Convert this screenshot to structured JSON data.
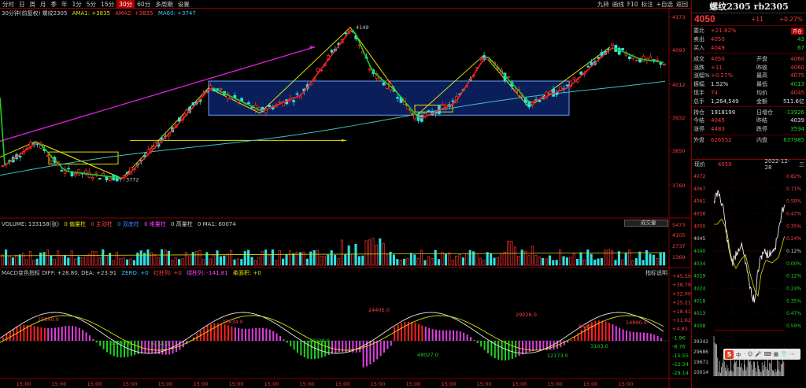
{
  "toolbar": {
    "items": [
      "分时",
      "日",
      "周",
      "月",
      "季",
      "年",
      "1分",
      "5分",
      "15分",
      "30分",
      "60分",
      "多周期",
      "设置"
    ],
    "active_index": 9,
    "right_items": [
      "九转",
      "画线",
      "F10",
      "标注",
      "+自选",
      "返回"
    ]
  },
  "main_legend": {
    "title": "30分钟(前复权) 螺纹2305",
    "ma1": "AMA1: +3835",
    "ma2": "AMA2: +3835",
    "ma60": "MA60: +3747",
    "colors": {
      "ma1": "#e0e000",
      "ma2": "#ff4040",
      "ma60": "#40c0ff"
    }
  },
  "price_axis": [
    "4173",
    "4093",
    "4012",
    "3932",
    "3850",
    "3760"
  ],
  "annotations": {
    "high": "4149",
    "low": "3772"
  },
  "volume_legend": {
    "text": "VOLUME: 133158(张)",
    "items": [
      "0 偏量柱",
      "0 主动柱",
      "0 双底柱",
      "0 堆量柱",
      "0 高量柱",
      "0 MA1: 60074"
    ],
    "select_label": "成交量"
  },
  "volume_axis": [
    "5473",
    "4105",
    "2737",
    "1369"
  ],
  "macd_legend": {
    "text": "MACD变色指标 DIFF: +28.80, DEA: +23.91",
    "items": [
      "ZERO: +0",
      "红柱列: +0",
      "绿柱列: -141.81",
      "柔面积: +0"
    ],
    "help": "指标说明"
  },
  "macd_axis": [
    "+45.59",
    "+38.79",
    "+32.00",
    "+25.21",
    "+18.41",
    "+11.62",
    "+4.83",
    "-1.96",
    "-8.76",
    "-15.55",
    "-22.34",
    "-29.14"
  ],
  "macd_labels": [
    "15840.0",
    "15030.0",
    "6154.0",
    "27834.0",
    "22229.0",
    "24405.0",
    "48027.0",
    "29026.0",
    "12173.0",
    "3103.0",
    "8547.0",
    "14890.0"
  ],
  "time_axis": [
    "15:00",
    "15:00",
    "15:00",
    "15:00",
    "15:00",
    "15:00",
    "15:00",
    "15:00",
    "15:00",
    "15:00",
    "15:00",
    "15:00",
    "15:00",
    "15:00",
    "15:00",
    "15:00",
    "15:00",
    "15:00",
    "15:00"
  ],
  "quote": {
    "title": "螺纹2305 rb2305",
    "price": "4050",
    "change": "+11",
    "pct": "+0.27%",
    "rows": [
      {
        "l": "委比",
        "v": "+21.82%",
        "l2": "",
        "v2": "24",
        "tag": "开仓"
      },
      {
        "l": "卖出",
        "v": "4050",
        "l2": "",
        "v2": "43"
      },
      {
        "l": "买入",
        "v": "4049",
        "l2": "",
        "v2": "67"
      },
      {
        "l": "成交",
        "v": "4050",
        "l2": "开盘",
        "v2": "4060"
      },
      {
        "l": "涨跌",
        "v": "+11",
        "l2": "昨收",
        "v2": "4060"
      },
      {
        "l": "涨幅%",
        "v": "+0.27%",
        "l2": "最高",
        "v2": "4075"
      },
      {
        "l": "振幅",
        "v": "1.52%",
        "l2": "最低",
        "v2": "4013"
      },
      {
        "l": "现手",
        "v": "74",
        "l2": "均价",
        "v2": "4045"
      },
      {
        "l": "总手",
        "v": "1,264,549",
        "l2": "金额",
        "v2": "511.6亿"
      },
      {
        "l": "持仓",
        "v": "1918199",
        "l2": "日增仓",
        "v2": "-13926"
      },
      {
        "l": "今结",
        "v": "4045",
        "l2": "昨结",
        "v2": "4039"
      },
      {
        "l": "涨停",
        "v": "4483",
        "l2": "跌停",
        "v2": "3594"
      },
      {
        "l": "外盘",
        "v": "626552",
        "l2": "内盘",
        "v2": "637985"
      }
    ]
  },
  "mini_chart": {
    "label": "现价",
    "price": "4050",
    "date": "2022-12-28",
    "day": "三",
    "left_axis": [
      "4072",
      "4067",
      "4061",
      "4056",
      "4050",
      "4045",
      "4040",
      "4034",
      "4029",
      "4024",
      "4018",
      "4013",
      "4008"
    ],
    "right_axis": [
      "0.82%",
      "0.71%",
      "0.59%",
      "0.47%",
      "0.35%",
      "0.24%",
      "0.12%",
      "0.00%",
      "0.12%",
      "0.24%",
      "0.35%",
      "0.47%",
      "0.59%",
      "0.71%",
      "0.82%"
    ],
    "vol_axis": [
      "39342",
      "29686",
      "19671",
      "10014"
    ]
  },
  "floating_toolbar": {
    "logo": "S",
    "items": [
      "中",
      "·",
      "☺",
      "🎤",
      "⌨",
      "▦",
      "👕",
      "⋯"
    ]
  }
}
